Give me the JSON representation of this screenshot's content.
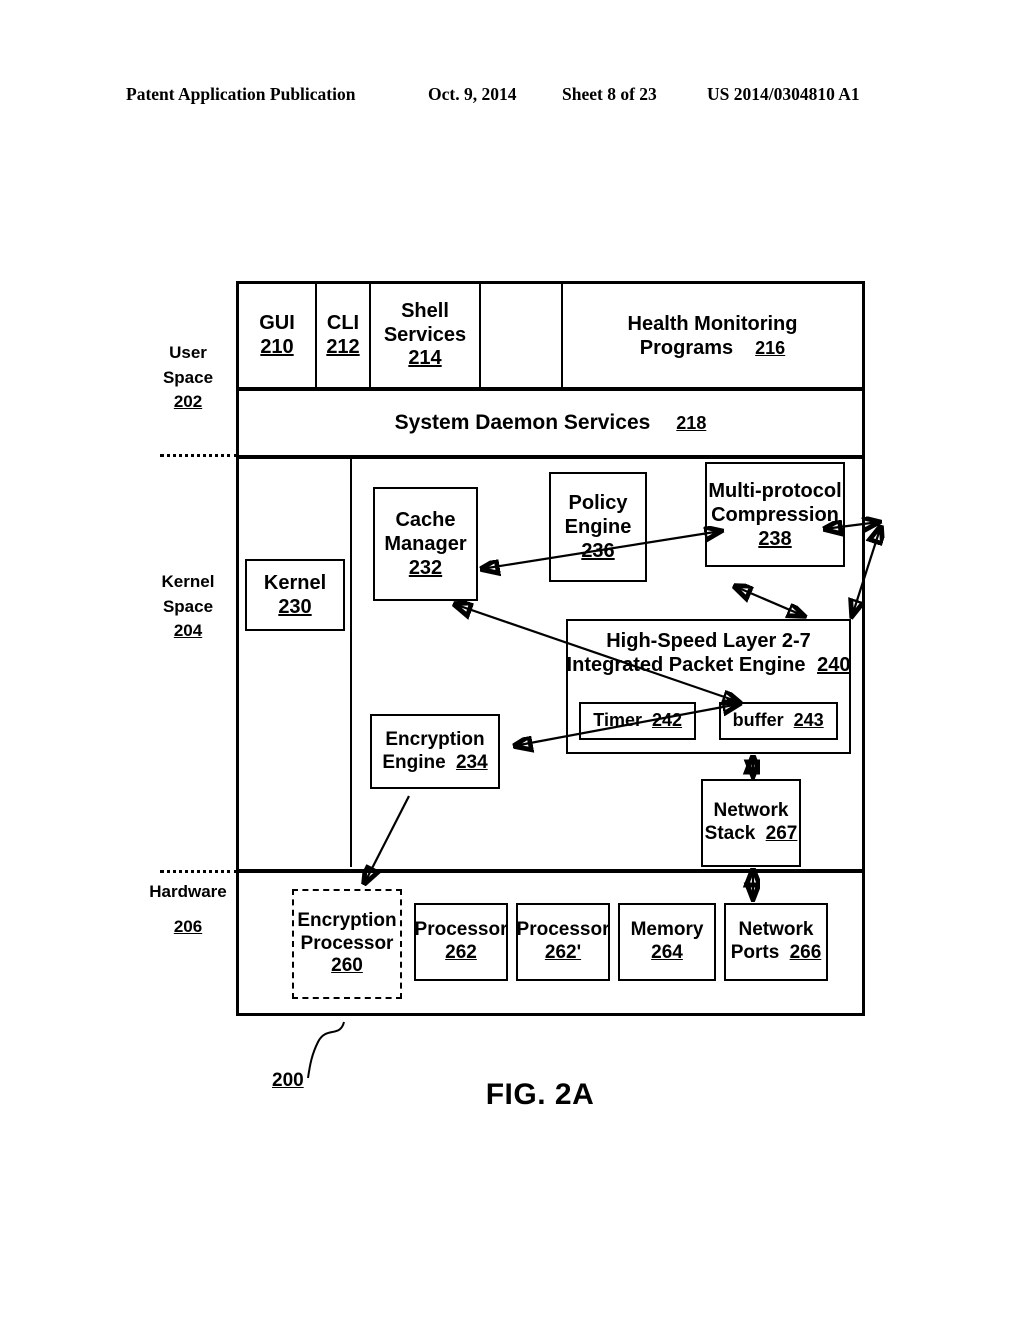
{
  "header": {
    "publication": "Patent Application Publication",
    "date": "Oct. 9, 2014",
    "sheet": "Sheet 8 of 23",
    "patent_number": "US 2014/0304810 A1"
  },
  "figure": {
    "caption": "FIG. 2A",
    "system_ref": "200"
  },
  "margin_labels": {
    "user_space": {
      "line1": "User",
      "line2": "Space",
      "ref": "202"
    },
    "kernel_space": {
      "line1": "Kernel",
      "line2": "Space",
      "ref": "204"
    },
    "hardware": {
      "line1": "Hardware",
      "ref": "206"
    }
  },
  "user_space": {
    "cells": [
      {
        "label": "GUI",
        "ref": "210"
      },
      {
        "label": "CLI",
        "ref": "212"
      },
      {
        "label": "Shell Services",
        "ref": "214"
      },
      {
        "label": "",
        "ref": ""
      },
      {
        "label_line1": "Health Monitoring",
        "label_line2": "Programs",
        "ref": "216"
      }
    ],
    "daemon": {
      "label": "System Daemon Services",
      "ref": "218"
    }
  },
  "kernel_space": {
    "kernel": {
      "label": "Kernel",
      "ref": "230"
    },
    "cache_manager": {
      "line1": "Cache",
      "line2": "Manager",
      "ref": "232"
    },
    "policy_engine": {
      "line1": "Policy",
      "line2": "Engine",
      "ref": "236"
    },
    "multi_protocol_compression": {
      "line1": "Multi-protocol",
      "line2": "Compression",
      "ref": "238"
    },
    "packet_engine": {
      "line1": "High-Speed Layer 2-7",
      "line2": "Integrated Packet Engine",
      "ref": "240",
      "timer": {
        "label": "Timer",
        "ref": "242"
      },
      "buffer": {
        "label": "buffer",
        "ref": "243"
      }
    },
    "encryption_engine": {
      "line1": "Encryption",
      "line2": "Engine",
      "ref": "234"
    },
    "network_stack": {
      "line1": "Network",
      "line2": "Stack",
      "ref": "267"
    }
  },
  "hardware": {
    "boxes": [
      {
        "line1": "Encryption",
        "line2": "Processor",
        "ref": "260",
        "style": "dashed"
      },
      {
        "line1": "Processor",
        "ref": "262",
        "style": "solid"
      },
      {
        "line1": "Processor",
        "ref": "262'",
        "style": "solid"
      },
      {
        "line1": "Memory",
        "ref": "264",
        "style": "solid"
      },
      {
        "line1": "Network",
        "line2": "Ports",
        "ref": "266",
        "style": "solid"
      }
    ]
  },
  "colors": {
    "line": "#000000",
    "background": "#ffffff"
  }
}
